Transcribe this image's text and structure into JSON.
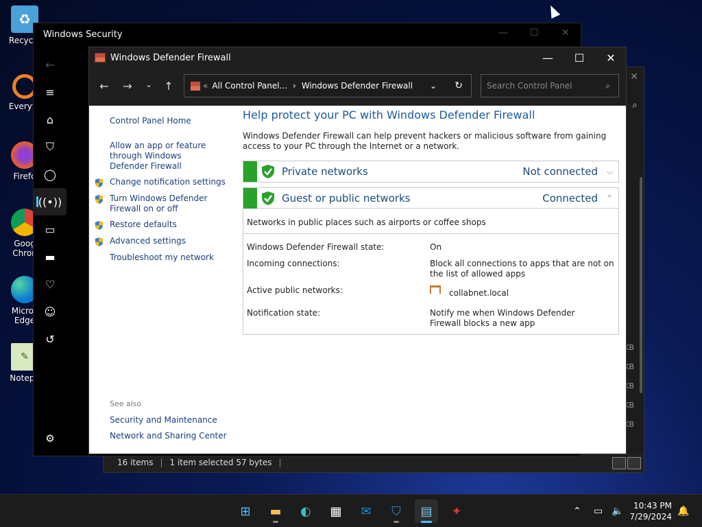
{
  "desktop": {
    "icons": [
      {
        "label": "Recycle",
        "icon": "recycle-bin-icon"
      },
      {
        "label": "Everyth",
        "icon": "everything-search-icon"
      },
      {
        "label": "Firefo",
        "icon": "firefox-icon"
      },
      {
        "label": "Goog Chron",
        "icon": "google-chrome-icon"
      },
      {
        "label": "Micros Edge",
        "icon": "edge-icon"
      },
      {
        "label": "Notepa",
        "icon": "notepad-icon"
      }
    ]
  },
  "background_explorer": {
    "status": {
      "items": "16 items",
      "selected": "1 item selected  57 bytes"
    },
    "size_suffix": "KB"
  },
  "windows_security": {
    "title": "Windows Security",
    "nav": [
      "back-icon",
      "menu-icon",
      "home-icon",
      "shield-icon",
      "account-icon",
      "firewall-network-icon",
      "app-browser-icon",
      "device-security-icon",
      "device-health-icon",
      "family-icon",
      "history-icon"
    ],
    "settings_icon": "gear-icon"
  },
  "firewall": {
    "title": "Windows Defender Firewall",
    "breadcrumb": {
      "parent": "All Control Panel...",
      "current": "Windows Defender Firewall",
      "prefix": "«"
    },
    "search_placeholder": "Search Control Panel",
    "left_links": {
      "home": "Control Panel Home",
      "allow_app": "Allow an app or feature through Windows Defender Firewall",
      "change_notifications": "Change notification settings",
      "turn_on_off": "Turn Windows Defender Firewall on or off",
      "restore_defaults": "Restore defaults",
      "advanced": "Advanced settings",
      "troubleshoot": "Troubleshoot my network"
    },
    "see_also": {
      "label": "See also",
      "security_maintenance": "Security and Maintenance",
      "network_sharing": "Network and Sharing Center"
    },
    "heading": "Help protect your PC with Windows Defender Firewall",
    "description": "Windows Defender Firewall can help prevent hackers or malicious software from gaining access to your PC through the Internet or a network.",
    "private": {
      "name": "Private networks",
      "state": "Not connected"
    },
    "public": {
      "name": "Guest or public networks",
      "state": "Connected",
      "summary": "Networks in public places such as airports or coffee shops",
      "firewall_state_label": "Windows Defender Firewall state:",
      "firewall_state_value": "On",
      "incoming_label": "Incoming connections:",
      "incoming_value": "Block all connections to apps that are not on the list of allowed apps",
      "active_label": "Active public networks:",
      "active_value": "collabnet.local",
      "notification_label": "Notification state:",
      "notification_value": "Notify me when Windows Defender Firewall blocks a new app"
    },
    "colors": {
      "green": "#2aa22a",
      "link": "#1a3f7a",
      "heading": "#1a5a9e"
    }
  },
  "taskbar": {
    "apps": [
      "start-icon",
      "file-explorer-icon",
      "edge-icon",
      "store-icon",
      "outlook-icon",
      "windows-security-icon",
      "control-panel-icon",
      "app-icon"
    ],
    "time": "10:43 PM",
    "date": "7/29/2024"
  }
}
